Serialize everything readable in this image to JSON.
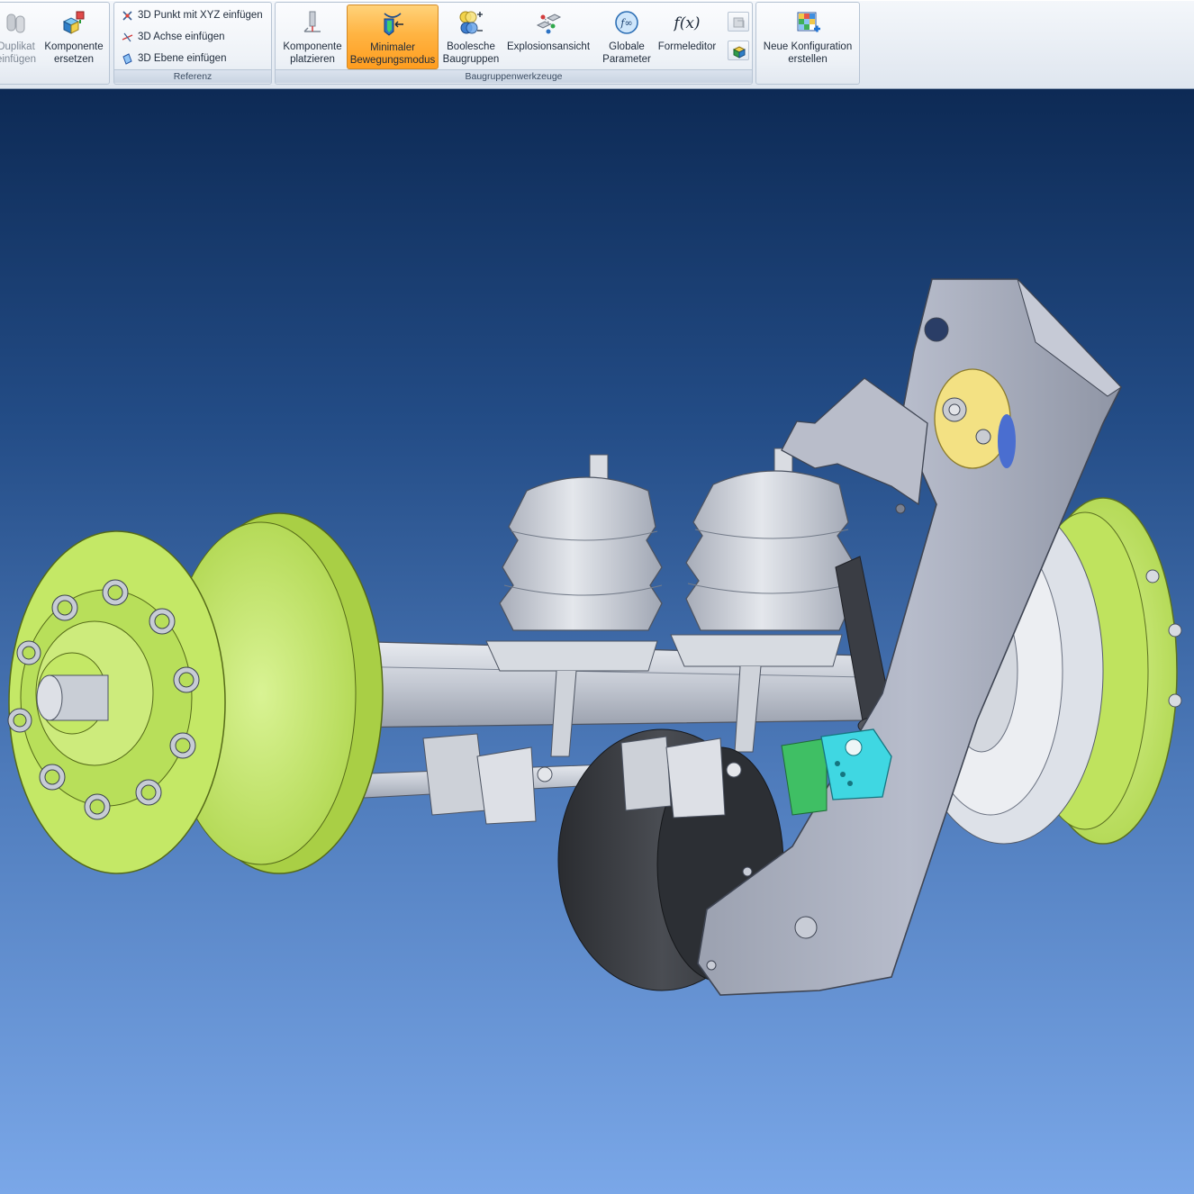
{
  "ribbon": {
    "groups": {
      "components": {
        "duplicate_line1": "Duplikat",
        "duplicate_line2": "einfügen",
        "replace_line1": "Komponente",
        "replace_line2": "ersetzen"
      },
      "reference": {
        "label": "Referenz",
        "point_label": "3D Punkt mit XYZ einfügen",
        "axis_label": "3D Achse einfügen",
        "plane_label": "3D Ebene einfügen"
      },
      "assembly_tools": {
        "label": "Baugruppenwerkzeuge",
        "place_line1": "Komponente",
        "place_line2": "platzieren",
        "minmotion_line1": "Minimaler",
        "minmotion_line2": "Bewegungsmodus",
        "boolean_line1": "Boolesche",
        "boolean_line2": "Baugruppen",
        "explode_label": "Explosionsansicht",
        "globals_line1": "Globale",
        "globals_line2": "Parameter",
        "formula_label": "Formeleditor",
        "formula_icon_text": "f(x)",
        "globals_icon_text": "f∞"
      },
      "configuration": {
        "new_config_line1": "Neue Konfiguration",
        "new_config_line2": "erstellen"
      }
    },
    "active_tool": "Minimaler Bewegungsmodus"
  },
  "viewport": {
    "model": "axle-suspension-assembly",
    "colors": {
      "hub": "#c4e866",
      "steel": "#c9ced8",
      "arm": "#a9aebd",
      "tire": "#3a3d42",
      "bracket_cyan": "#3fd7e2",
      "bracket_green": "#3fbf64",
      "washer_yellow": "#f3e183"
    }
  }
}
